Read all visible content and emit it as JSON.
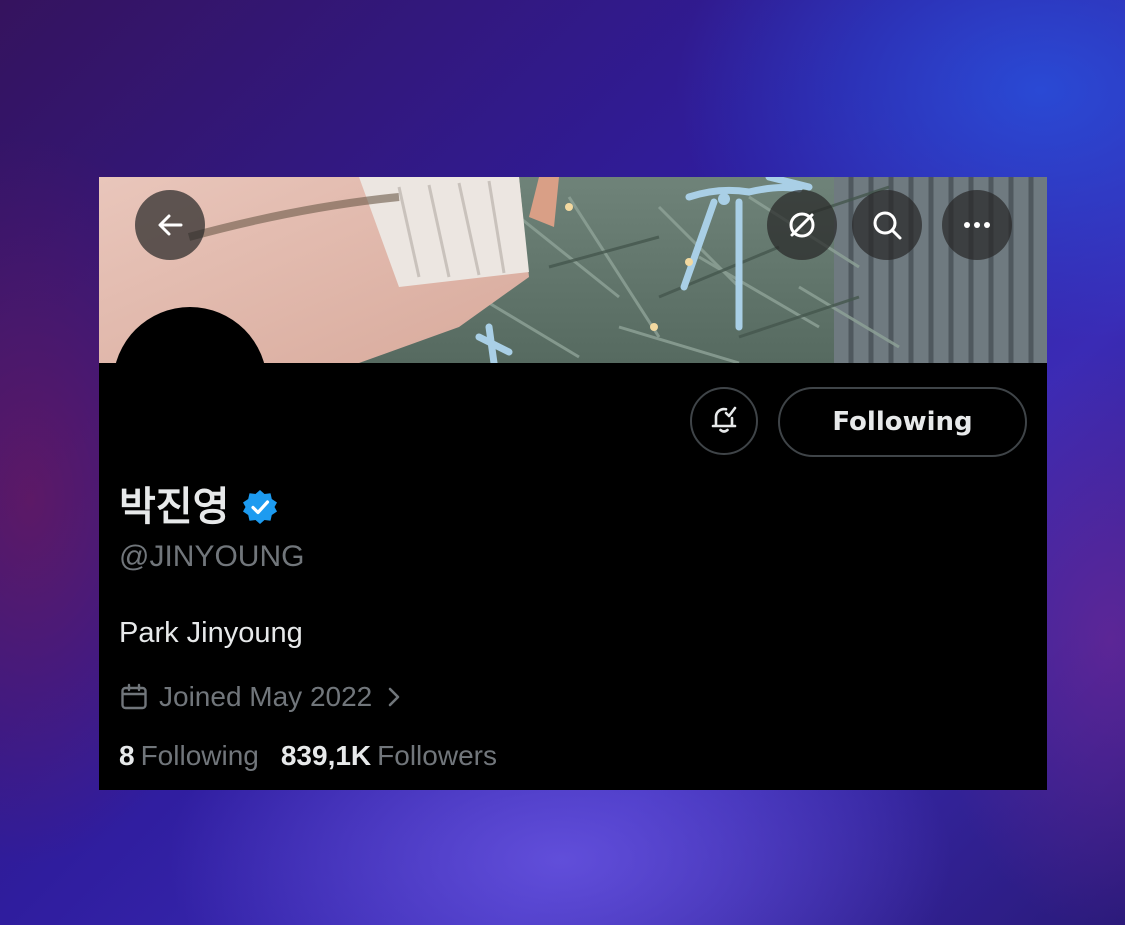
{
  "profile": {
    "display_name": "박진영",
    "handle": "@JINYOUNG",
    "bio": "Park Jinyoung",
    "joined": "Joined May 2022",
    "following_count": "8",
    "following_label": "Following",
    "followers_count": "839,1K",
    "followers_label": "Followers"
  },
  "actions": {
    "follow_state_label": "Following"
  },
  "icons": {
    "back": "arrow-left-icon",
    "translate": "slashed-circle-icon",
    "search": "search-icon",
    "more": "more-horizontal-icon",
    "notifications": "bell-check-icon",
    "verified": "verified-badge-icon",
    "calendar": "calendar-icon",
    "chevron": "chevron-right-icon"
  },
  "colors": {
    "page_background": "#000000",
    "primary_text": "#e7e9ea",
    "secondary_text": "#71767b",
    "verified_blue": "#1d9bf0",
    "button_border": "#3f4448"
  }
}
